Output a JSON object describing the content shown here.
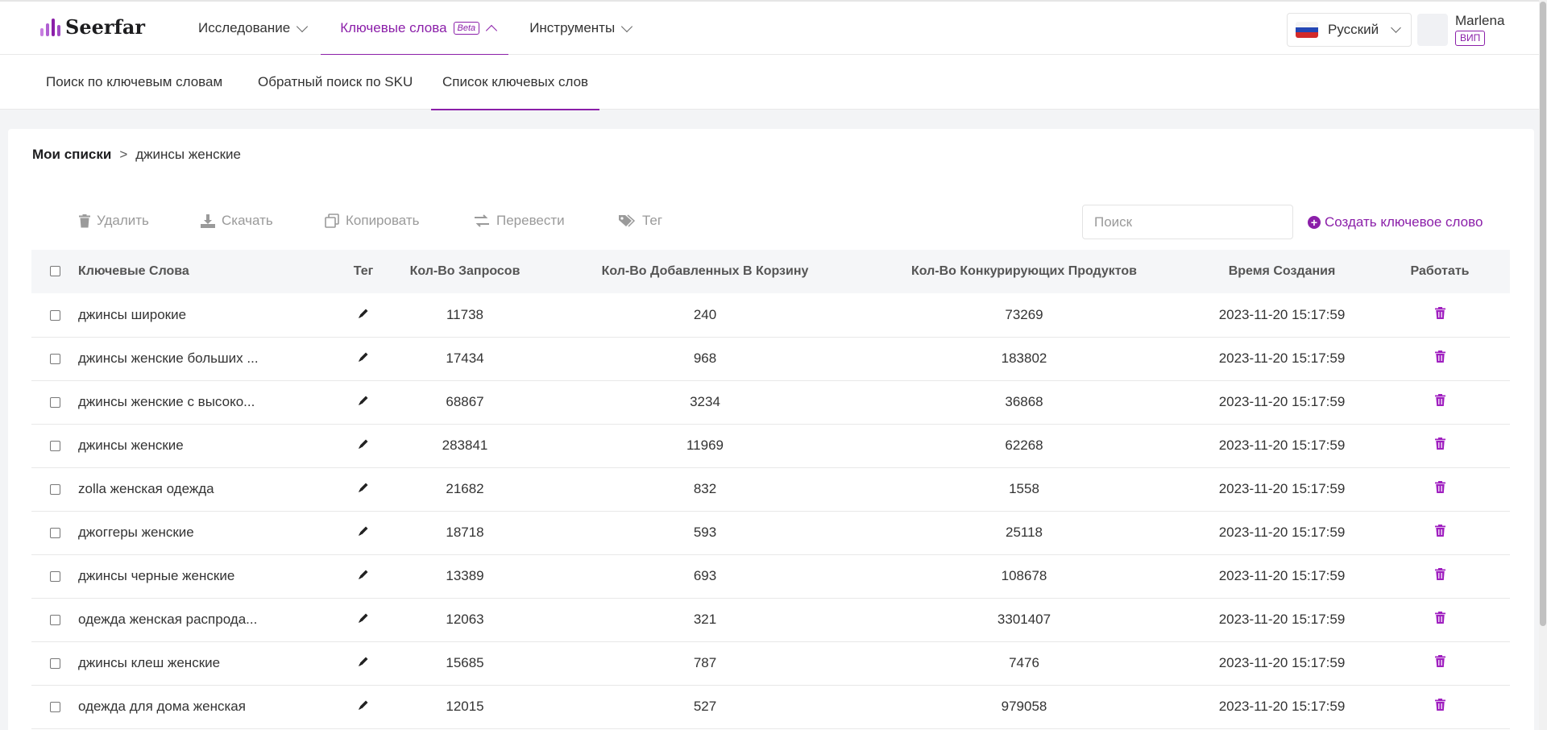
{
  "brand": {
    "name": "Seerfar",
    "colors": {
      "accent": "#8b1fa9"
    }
  },
  "nav": {
    "items": [
      {
        "label": "Исследование"
      },
      {
        "label": "Ключевые слова",
        "badge": "Beta"
      },
      {
        "label": "Инструменты"
      }
    ]
  },
  "language": {
    "selected": "Русский"
  },
  "user": {
    "name": "Marlena",
    "badge": "ВИП"
  },
  "subnav": {
    "items": [
      {
        "label": "Поиск по ключевым словам"
      },
      {
        "label": "Обратный поиск по SKU"
      },
      {
        "label": "Список ключевых слов"
      }
    ]
  },
  "breadcrumb": {
    "root": "Мои списки",
    "separator": ">",
    "current": "джинсы женские"
  },
  "toolbar": {
    "delete": "Удалить",
    "download": "Скачать",
    "copy": "Копировать",
    "translate": "Перевести",
    "tag": "Тег",
    "search_placeholder": "Поиск",
    "create": "Создать ключевое слово"
  },
  "table": {
    "headers": {
      "keyword": "Ключевые Слова",
      "tag": "Тег",
      "queries": "Кол-Во Запросов",
      "cart": "Кол-Во Добавленных В Корзину",
      "competitors": "Кол-Во Конкурирующих Продуктов",
      "created": "Время Создания",
      "action": "Работать"
    },
    "rows": [
      {
        "keyword": "джинсы широкие",
        "queries": "11738",
        "cart": "240",
        "competitors": "73269",
        "created": "2023-11-20 15:17:59"
      },
      {
        "keyword": "джинсы женские больших ...",
        "queries": "17434",
        "cart": "968",
        "competitors": "183802",
        "created": "2023-11-20 15:17:59"
      },
      {
        "keyword": "джинсы женские с высоко...",
        "queries": "68867",
        "cart": "3234",
        "competitors": "36868",
        "created": "2023-11-20 15:17:59"
      },
      {
        "keyword": "джинсы женские",
        "queries": "283841",
        "cart": "11969",
        "competitors": "62268",
        "created": "2023-11-20 15:17:59"
      },
      {
        "keyword": "zolla женская одежда",
        "queries": "21682",
        "cart": "832",
        "competitors": "1558",
        "created": "2023-11-20 15:17:59"
      },
      {
        "keyword": "джоггеры женские",
        "queries": "18718",
        "cart": "593",
        "competitors": "25118",
        "created": "2023-11-20 15:17:59"
      },
      {
        "keyword": "джинсы черные женские",
        "queries": "13389",
        "cart": "693",
        "competitors": "108678",
        "created": "2023-11-20 15:17:59"
      },
      {
        "keyword": "одежда женская распрода...",
        "queries": "12063",
        "cart": "321",
        "competitors": "3301407",
        "created": "2023-11-20 15:17:59"
      },
      {
        "keyword": "джинсы клеш женские",
        "queries": "15685",
        "cart": "787",
        "competitors": "7476",
        "created": "2023-11-20 15:17:59"
      },
      {
        "keyword": "одежда для дома женская",
        "queries": "12015",
        "cart": "527",
        "competitors": "979058",
        "created": "2023-11-20 15:17:59"
      }
    ]
  },
  "icons": [
    "logo-icon",
    "chevron-down-icon",
    "chevron-up-icon",
    "flag-icon",
    "trash-icon",
    "download-icon",
    "copy-icon",
    "translate-icon",
    "tag-icon",
    "plus-circle-icon",
    "pencil-icon"
  ]
}
